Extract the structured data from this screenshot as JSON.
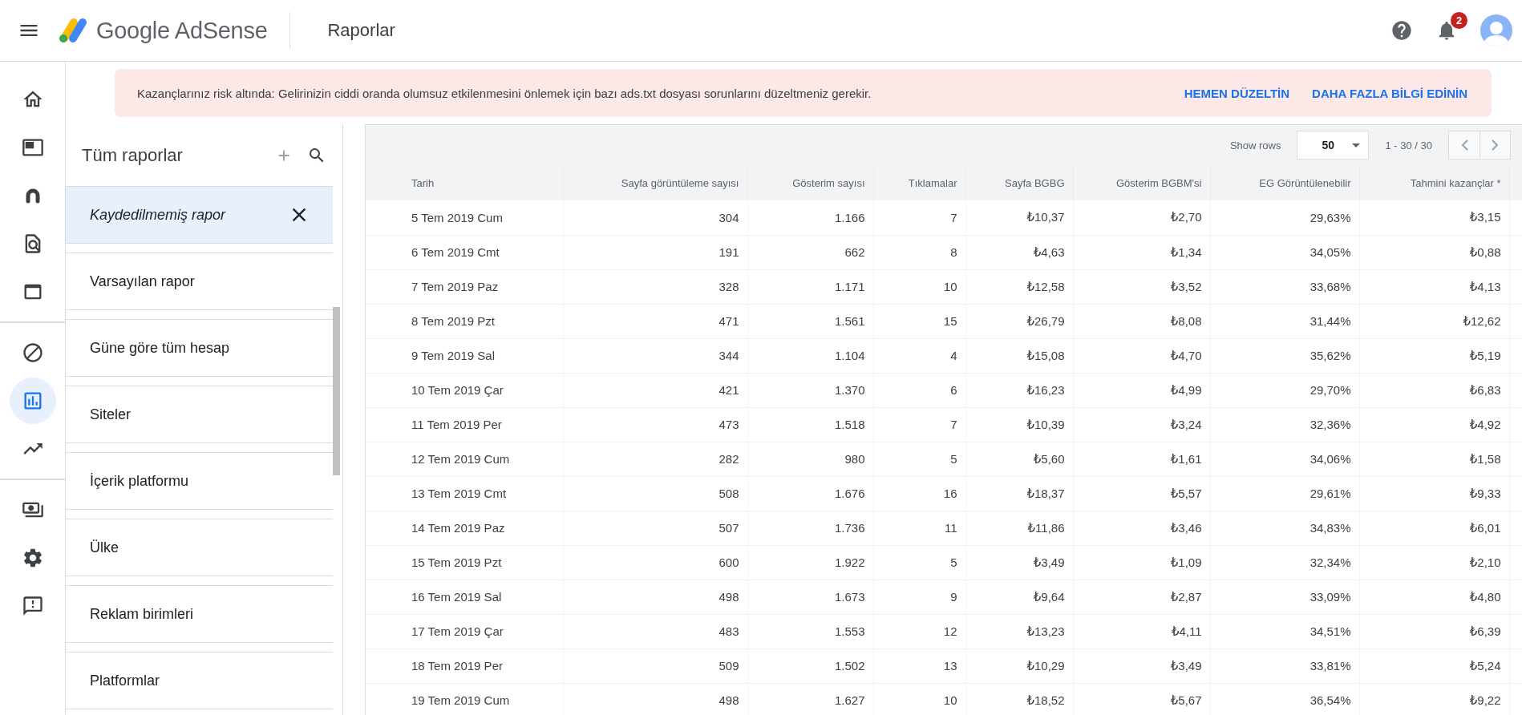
{
  "topbar": {
    "brand": "Google AdSense",
    "title": "Raporlar",
    "notification_count": "2"
  },
  "nav_rail": {
    "groups": [
      [
        {
          "selected": false
        },
        {
          "selected": false
        },
        {
          "selected": false
        },
        {
          "selected": false
        },
        {
          "selected": false
        }
      ],
      [
        {
          "selected": false
        },
        {
          "selected": true
        },
        {
          "selected": false
        }
      ],
      [
        {
          "selected": false
        },
        {
          "selected": false
        },
        {
          "selected": false
        }
      ]
    ]
  },
  "alert": {
    "message": "Kazançlarınız risk altında: Gelirinizin ciddi oranda olumsuz etkilenmesini önlemek için bazı ads.txt dosyası sorunlarını düzeltmeniz gerekir.",
    "actions": [
      "HEMEN DÜZELTİN",
      "DAHA FAZLA BİLGİ EDİNİN"
    ]
  },
  "reports_panel": {
    "title": "Tüm raporlar",
    "items": [
      {
        "label": "Kaydedilmemiş rapor",
        "selected": true
      },
      {
        "label": "Varsayılan rapor",
        "selected": false
      },
      {
        "label": "Güne göre tüm hesap",
        "selected": false
      },
      {
        "label": "Siteler",
        "selected": false
      },
      {
        "label": "İçerik platformu",
        "selected": false
      },
      {
        "label": "Ülke",
        "selected": false
      },
      {
        "label": "Reklam birimleri",
        "selected": false
      },
      {
        "label": "Platformlar",
        "selected": false
      }
    ]
  },
  "table": {
    "show_rows_label": "Show rows",
    "rows_per_page": "50",
    "range": "1 - 30 / 30",
    "columns": [
      "Tarih",
      "Sayfa görüntüleme sayısı",
      "Gösterim sayısı",
      "Tıklamalar",
      "Sayfa BGBG",
      "Gösterim BGBM'si",
      "EG Görüntülenebilir",
      "Tahmini kazançlar *"
    ],
    "rows": [
      [
        "5 Tem 2019 Cum",
        "304",
        "1.166",
        "7",
        "₺10,37",
        "₺2,70",
        "29,63%",
        "₺3,15"
      ],
      [
        "6 Tem 2019 Cmt",
        "191",
        "662",
        "8",
        "₺4,63",
        "₺1,34",
        "34,05%",
        "₺0,88"
      ],
      [
        "7 Tem 2019 Paz",
        "328",
        "1.171",
        "10",
        "₺12,58",
        "₺3,52",
        "33,68%",
        "₺4,13"
      ],
      [
        "8 Tem 2019 Pzt",
        "471",
        "1.561",
        "15",
        "₺26,79",
        "₺8,08",
        "31,44%",
        "₺12,62"
      ],
      [
        "9 Tem 2019 Sal",
        "344",
        "1.104",
        "4",
        "₺15,08",
        "₺4,70",
        "35,62%",
        "₺5,19"
      ],
      [
        "10 Tem 2019 Çar",
        "421",
        "1.370",
        "6",
        "₺16,23",
        "₺4,99",
        "29,70%",
        "₺6,83"
      ],
      [
        "11 Tem 2019 Per",
        "473",
        "1.518",
        "7",
        "₺10,39",
        "₺3,24",
        "32,36%",
        "₺4,92"
      ],
      [
        "12 Tem 2019 Cum",
        "282",
        "980",
        "5",
        "₺5,60",
        "₺1,61",
        "34,06%",
        "₺1,58"
      ],
      [
        "13 Tem 2019 Cmt",
        "508",
        "1.676",
        "16",
        "₺18,37",
        "₺5,57",
        "29,61%",
        "₺9,33"
      ],
      [
        "14 Tem 2019 Paz",
        "507",
        "1.736",
        "11",
        "₺11,86",
        "₺3,46",
        "34,83%",
        "₺6,01"
      ],
      [
        "15 Tem 2019 Pzt",
        "600",
        "1.922",
        "5",
        "₺3,49",
        "₺1,09",
        "32,34%",
        "₺2,10"
      ],
      [
        "16 Tem 2019 Sal",
        "498",
        "1.673",
        "9",
        "₺9,64",
        "₺2,87",
        "33,09%",
        "₺4,80"
      ],
      [
        "17 Tem 2019 Çar",
        "483",
        "1.553",
        "12",
        "₺13,23",
        "₺4,11",
        "34,51%",
        "₺6,39"
      ],
      [
        "18 Tem 2019 Per",
        "509",
        "1.502",
        "13",
        "₺10,29",
        "₺3,49",
        "33,81%",
        "₺5,24"
      ],
      [
        "19 Tem 2019 Cum",
        "498",
        "1.627",
        "10",
        "₺18,52",
        "₺5,67",
        "36,54%",
        "₺9,22"
      ]
    ]
  }
}
